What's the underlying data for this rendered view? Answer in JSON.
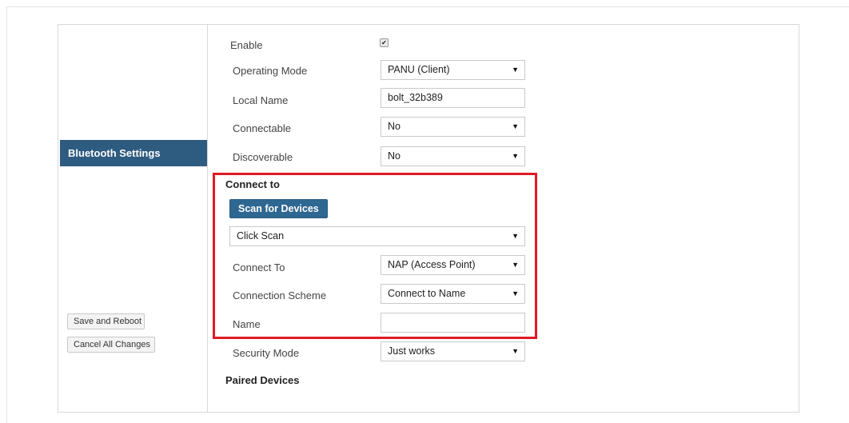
{
  "sidebar": {
    "active_item": "Bluetooth Settings",
    "save_button": "Save and Reboot",
    "cancel_button": "Cancel All Changes"
  },
  "colors": {
    "accent": "#2e5b80",
    "highlight_border": "#e01b24"
  },
  "form": {
    "enable": {
      "label": "Enable",
      "checked": true,
      "check_glyph": "✔"
    },
    "operating_mode": {
      "label": "Operating Mode",
      "value": "PANU (Client)"
    },
    "local_name": {
      "label": "Local Name",
      "value": "bolt_32b389"
    },
    "connectable": {
      "label": "Connectable",
      "value": "No"
    },
    "discoverable": {
      "label": "Discoverable",
      "value": "No"
    },
    "connect_to_section": {
      "heading": "Connect to",
      "scan_button": "Scan for Devices",
      "device_select": "Click Scan",
      "connect_to": {
        "label": "Connect To",
        "value": "NAP (Access Point)"
      },
      "connection_scheme": {
        "label": "Connection Scheme",
        "value": "Connect to Name"
      },
      "name": {
        "label": "Name",
        "value": ""
      }
    },
    "security_mode": {
      "label": "Security Mode",
      "value": "Just works"
    },
    "paired_devices_heading": "Paired Devices"
  },
  "caret_glyph": "▼"
}
